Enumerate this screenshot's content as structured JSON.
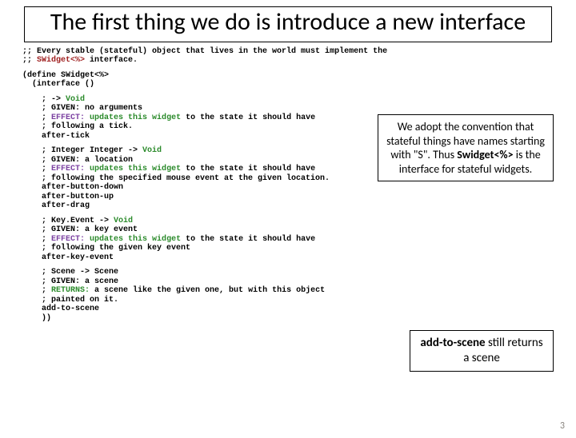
{
  "title": "The first thing we do is introduce a new interface",
  "code": {
    "c1a": ";; Every stable (stateful) object that lives in the world must implement the",
    "c1b_p": ";; ",
    "c1b_kw": "SWidget<%>",
    "c1b_s": " interface.",
    "c2a": "(define SWidget<%>",
    "c2b": "  (interface ()",
    "b1l1_p": "    ; -> ",
    "b1l1_kw": "Void",
    "b1l2": "    ; GIVEN: no arguments",
    "b1l3_p": "    ; ",
    "b1l3_kw": "EFFECT:",
    "b1l3_s1": " ",
    "b1l3_kw2": "updates this widget",
    "b1l3_s2": " to the state it should have",
    "b1l4": "    ; following a tick.",
    "b1m": "    after-tick",
    "b2l1_p": "    ; Integer Integer -> ",
    "b2l1_kw": "Void",
    "b2l2": "    ; GIVEN: a location",
    "b2l3_p": "    ; ",
    "b2l3_kw": "EFFECT:",
    "b2l3_s1": " ",
    "b2l3_kw2": "updates this widget",
    "b2l3_s2": " to the state it should have",
    "b2l4": "    ; following the specified mouse event at the given location.",
    "b2m1": "    after-button-down",
    "b2m2": "    after-button-up",
    "b2m3": "    after-drag",
    "b3l1_p": "    ; Key.Event -> ",
    "b3l1_kw": "Void",
    "b3l2": "    ; GIVEN: a key event",
    "b3l3_p": "    ; ",
    "b3l3_kw": "EFFECT:",
    "b3l3_s1": " ",
    "b3l3_kw2": "updates this widget",
    "b3l3_s2": " to the state it should have",
    "b3l4": "    ; following the given key event",
    "b3m": "    after-key-event",
    "b4l1": "    ; Scene -> Scene",
    "b4l2": "    ; GIVEN: a scene",
    "b4l3_p": "    ; ",
    "b4l3_kw": "RETURNS:",
    "b4l3_s": " a scene like the given one, but with this object",
    "b4l4": "    ; painted on it.",
    "b4m": "    add-to-scene",
    "end": "    ))"
  },
  "callout1": {
    "t1": "We adopt the convention that stateful things have names starting with \"S\". Thus ",
    "t2": "Swidget<%>",
    "t3": " is the interface for stateful widgets."
  },
  "callout2": {
    "t1": "add-to-scene",
    "t2": " still returns a scene"
  },
  "page_number": "3"
}
